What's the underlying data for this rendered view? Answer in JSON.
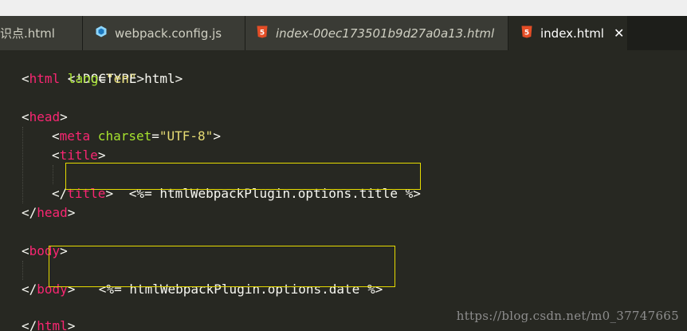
{
  "tabs": [
    {
      "label": "识点.html",
      "icon": "html5-icon",
      "italic": false,
      "active": false
    },
    {
      "label": "webpack.config.js",
      "icon": "webpack-cube-icon",
      "italic": false,
      "active": false
    },
    {
      "label": "index-00ec173501b9d27a0a13.html",
      "icon": "html5-icon",
      "italic": true,
      "active": false
    },
    {
      "label": "index.html",
      "icon": "html5-icon",
      "italic": false,
      "active": true,
      "close": "✕"
    }
  ],
  "code": {
    "l1": {
      "open": "<!DOCTYPE html>"
    },
    "l2": {
      "lt": "<",
      "tag": "html",
      "attr": " lang",
      "eq": "=",
      "val": "\"en\"",
      "gt": ">"
    },
    "l4": {
      "lt": "<",
      "tag": "head",
      "gt": ">"
    },
    "l5": {
      "lt": "<",
      "tag": "meta",
      "attr": " charset",
      "eq": "=",
      "val": "\"UTF-8\"",
      "gt": ">"
    },
    "l6": {
      "lt": "<",
      "tag": "title",
      "gt": ">"
    },
    "l7": {
      "text": "<%= htmlWebpackPlugin.options.title %>"
    },
    "l8": {
      "lt": "</",
      "tag": "title",
      "gt": ">"
    },
    "l9": {
      "lt": "</",
      "tag": "head",
      "gt": ">"
    },
    "l11": {
      "lt": "<",
      "tag": "body",
      "gt": ">"
    },
    "l12": {
      "text": "<%= htmlWebpackPlugin.options.date %>"
    },
    "l13": {
      "lt": "</",
      "tag": "body",
      "gt": ">"
    },
    "l15": {
      "lt": "</",
      "tag": "html",
      "gt": ">"
    }
  },
  "watermark": "https://blog.csdn.net/m0_37747665",
  "colors": {
    "background": "#272822",
    "tag": "#f92672",
    "attribute": "#a6e22e",
    "string": "#e6db74",
    "highlight_box": "#e6db00"
  }
}
